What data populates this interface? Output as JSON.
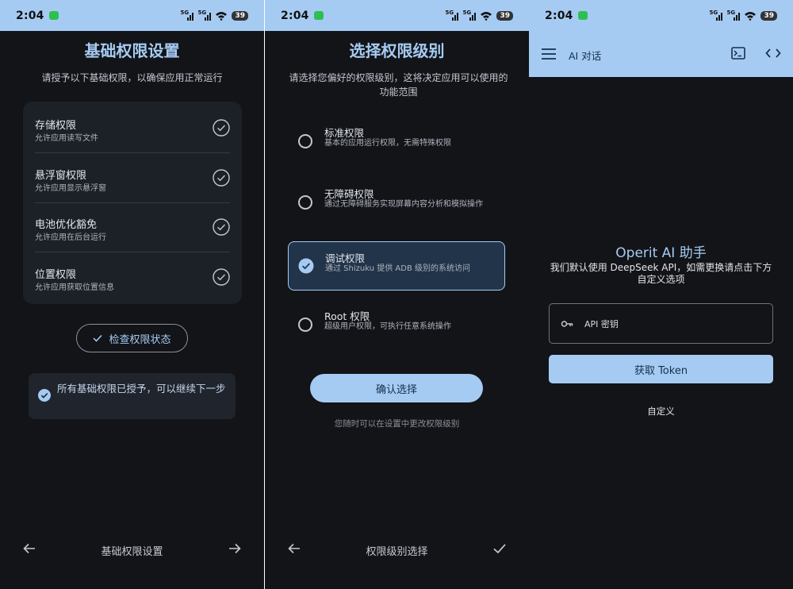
{
  "status_bar": {
    "time": "2:04",
    "network_badge": "5G",
    "battery": "39"
  },
  "screens": [
    {
      "title": "基础权限设置",
      "subtitle": "请授予以下基础权限，以确保应用正常运行",
      "permissions": [
        {
          "title": "存储权限",
          "desc": "允许应用读写文件"
        },
        {
          "title": "悬浮窗权限",
          "desc": "允许应用显示悬浮窗"
        },
        {
          "title": "电池优化豁免",
          "desc": "允许应用在后台运行"
        },
        {
          "title": "位置权限",
          "desc": "允许应用获取位置信息"
        }
      ],
      "check_button_label": "检查权限状态",
      "notice": "所有基础权限已授予，可以继续下一步",
      "bottom_title": "基础权限设置"
    },
    {
      "title": "选择权限级别",
      "subtitle": "请选择您偏好的权限级别，这将决定应用可以使用的功能范围",
      "options": [
        {
          "title": "标准权限",
          "desc": "基本的应用运行权限，无需特殊权限",
          "selected": false
        },
        {
          "title": "无障碍权限",
          "desc": "通过无障碍服务实现屏幕内容分析和模拟操作",
          "selected": false
        },
        {
          "title": "调试权限",
          "desc": "通过 Shizuku 提供 ADB 级别的系统访问",
          "selected": true
        },
        {
          "title": "Root 权限",
          "desc": "超级用户权限，可执行任意系统操作",
          "selected": false
        }
      ],
      "confirm_label": "确认选择",
      "hint": "您随时可以在设置中更改权限级别",
      "bottom_title": "权限级别选择"
    },
    {
      "app_bar_title": "AI 对话",
      "ai_title": "Operit AI 助手",
      "ai_desc": "我们默认使用 DeepSeek API，如需更换请点击下方自定义选项",
      "api_placeholder": "API 密钥",
      "token_button_label": "获取 Token",
      "custom_label": "自定义"
    }
  ],
  "icons": {
    "check": "check-circle-icon",
    "arrow_back": "arrow-left-icon",
    "arrow_forward": "arrow-right-icon",
    "done": "check-icon",
    "menu": "hamburger-menu-icon",
    "terminal": "terminal-icon",
    "code": "code-icon",
    "key": "key-icon"
  },
  "colors": {
    "accent": "#a6cbf3",
    "background": "#121418",
    "card": "#1c2027"
  }
}
